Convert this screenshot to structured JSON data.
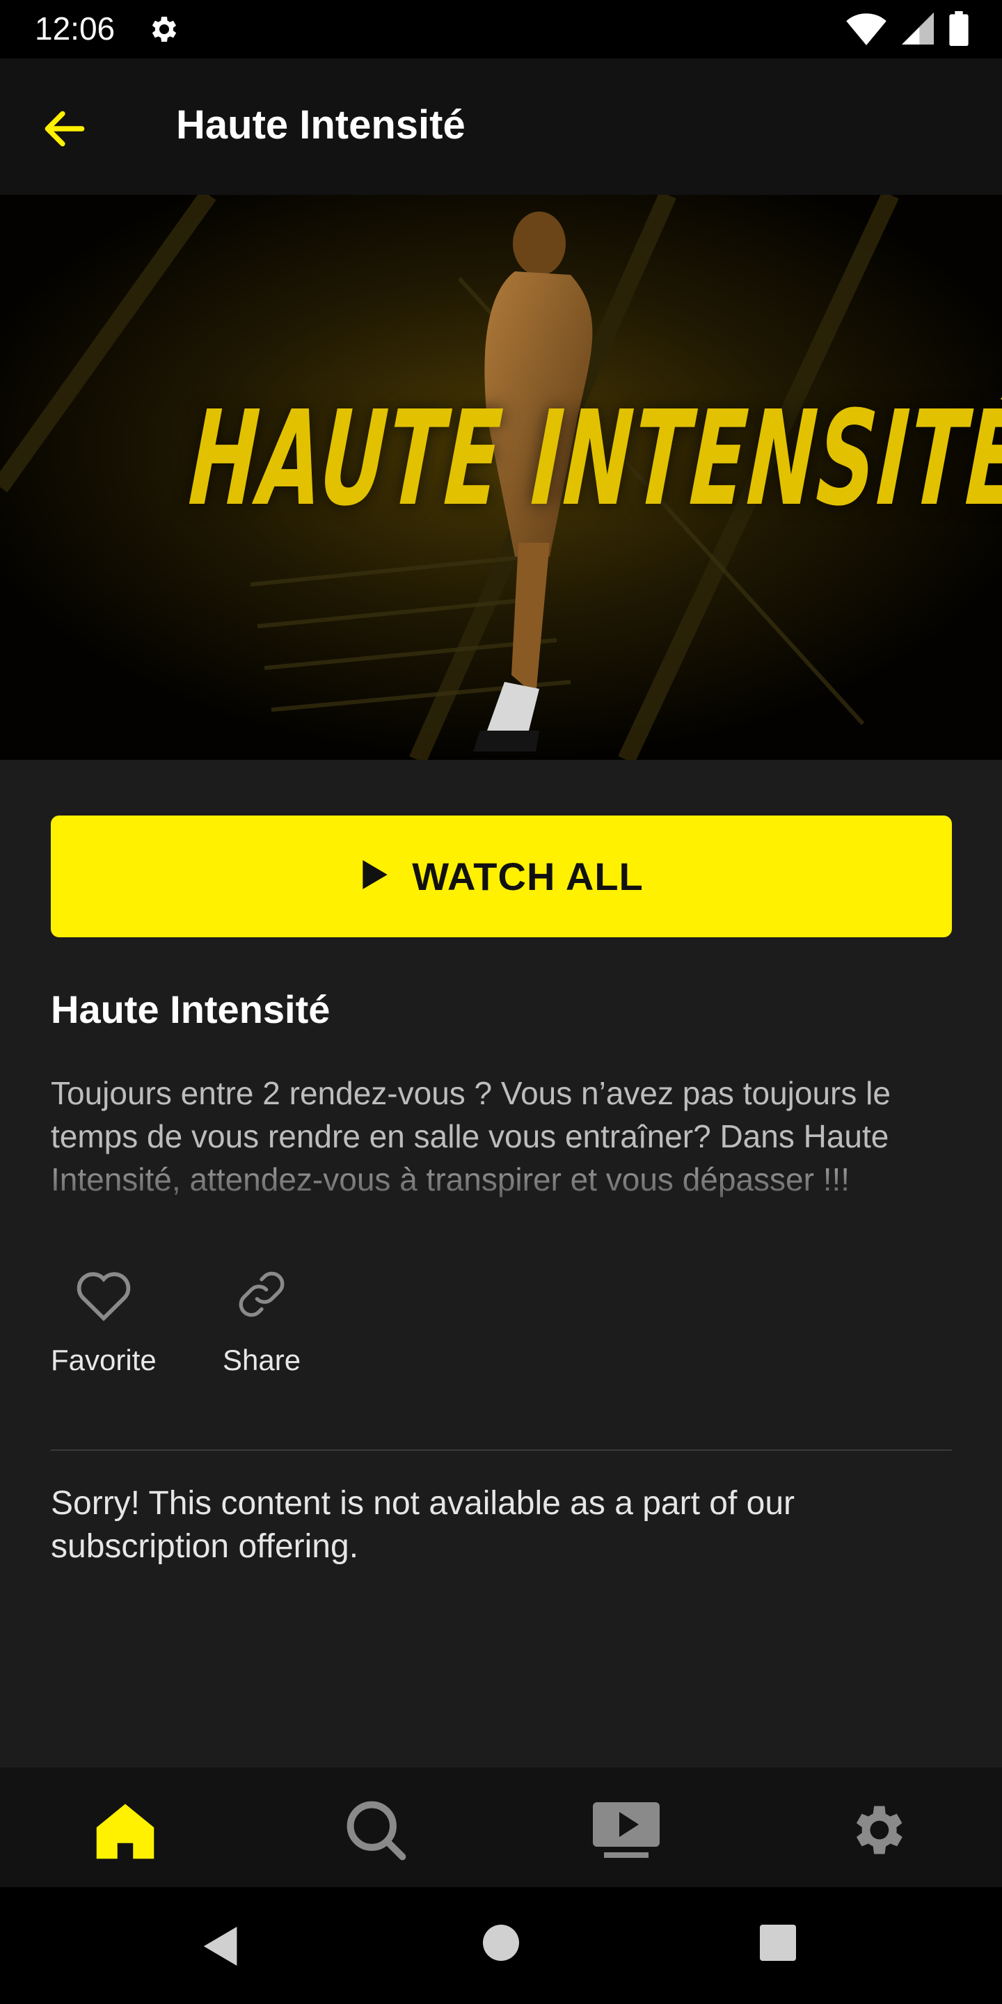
{
  "status_bar": {
    "time": "12:06",
    "icons": [
      "settings-icon",
      "wifi-icon",
      "signal-icon",
      "battery-icon"
    ]
  },
  "app_bar": {
    "back_icon": "arrow-left-icon",
    "title": "Haute Intensité"
  },
  "hero": {
    "title_text": "HAUTE INTENSITÉ"
  },
  "watch_button": {
    "icon": "play-icon",
    "label": "WATCH ALL"
  },
  "details": {
    "title": "Haute Intensité",
    "description": "Toujours entre 2 rendez-vous ? Vous n’avez pas toujours le temps de vous rendre en salle vous entraîner? Dans Haute Intensité, attendez-vous à transpirer et vous dépasser !!!"
  },
  "actions": {
    "favorite_label": "Favorite",
    "share_label": "Share"
  },
  "notice": "Sorry! This content is not available as a part of our subscription offering.",
  "bottom_nav": {
    "items": [
      "home-icon",
      "search-icon",
      "video-library-icon",
      "settings-icon"
    ],
    "active": "home-icon"
  },
  "colors": {
    "accent": "#fff100",
    "background": "#1c1c1c",
    "bar": "#121212",
    "inactive_icon": "#8a8a8a"
  }
}
